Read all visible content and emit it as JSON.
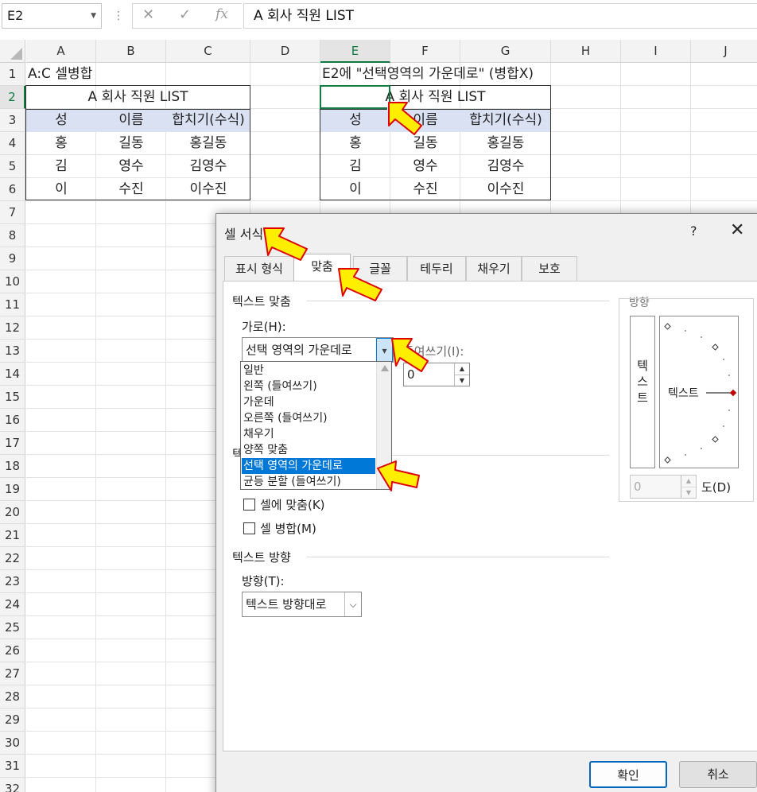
{
  "formula_bar": {
    "name_box": "E2",
    "dots": "⋮",
    "cancel_glyph": "✕",
    "enter_glyph": "✓",
    "fx_glyph": "fx",
    "formula": "A 회사 직원 LIST"
  },
  "columns": [
    "A",
    "B",
    "C",
    "D",
    "E",
    "F",
    "G",
    "H",
    "I",
    "J"
  ],
  "selected_column": "E",
  "rows": [
    "1",
    "2",
    "3",
    "4",
    "5",
    "6",
    "7",
    "8",
    "9",
    "10",
    "11",
    "12",
    "13",
    "14",
    "15",
    "16",
    "17",
    "18",
    "19",
    "20",
    "21",
    "22",
    "23",
    "24",
    "25",
    "26",
    "27",
    "28",
    "29",
    "30",
    "31",
    "32"
  ],
  "selected_row": "2",
  "sheet": {
    "a1": "A:C 셀병합",
    "e1": "E2에 \"선택영역의 가운데로\" (병합X)",
    "title_left": "A 회사 직원 LIST",
    "title_right": "A 회사 직원 LIST",
    "headers": [
      "성",
      "이름",
      "합치기(수식)"
    ],
    "data_rows": [
      [
        "홍",
        "길동",
        "홍길동"
      ],
      [
        "김",
        "영수",
        "김영수"
      ],
      [
        "이",
        "수진",
        "이수진"
      ]
    ],
    "header_fill": "#d9e1f2"
  },
  "dialog": {
    "title": "셀 서식",
    "help": "?",
    "close": "✕",
    "tabs": [
      "표시 형식",
      "맞춤",
      "글꼴",
      "테두리",
      "채우기",
      "보호"
    ],
    "active_tab": "맞춤",
    "text_alignment": {
      "section": "텍스트 맞춤",
      "horizontal_label": "가로(H):",
      "horizontal_value": "선택 영역의 가운데로",
      "indent_label": "들여쓰기(I):",
      "indent_value": "0",
      "vertical_section_partial": "텍",
      "options": [
        "일반",
        "왼쪽 (들여쓰기)",
        "가운데",
        "오른쪽 (들여쓰기)",
        "채우기",
        "양쪽 맞춤",
        "선택 영역의 가운데로",
        "균등 분할 (들여쓰기)"
      ],
      "selected_option": "선택 영역의 가운데로"
    },
    "text_control": {
      "shrink_to_fit": "셀에 맞춤(K)",
      "merge_cells": "셀 병합(M)"
    },
    "text_direction": {
      "section": "텍스트 방향",
      "label": "방향(T):",
      "value": "텍스트 방향대로"
    },
    "orientation": {
      "section": "방향",
      "vertical_text": [
        "텍",
        "스",
        "트"
      ],
      "dial_text": "텍스트",
      "degrees_value": "0",
      "degrees_label": "도(D)"
    },
    "ok": "확인",
    "cancel": "취소"
  },
  "colors": {
    "accent_green": "#107c41",
    "highlight_blue": "#0078d7",
    "arrow_fill": "#ffee00",
    "arrow_stroke": "#e00000"
  }
}
